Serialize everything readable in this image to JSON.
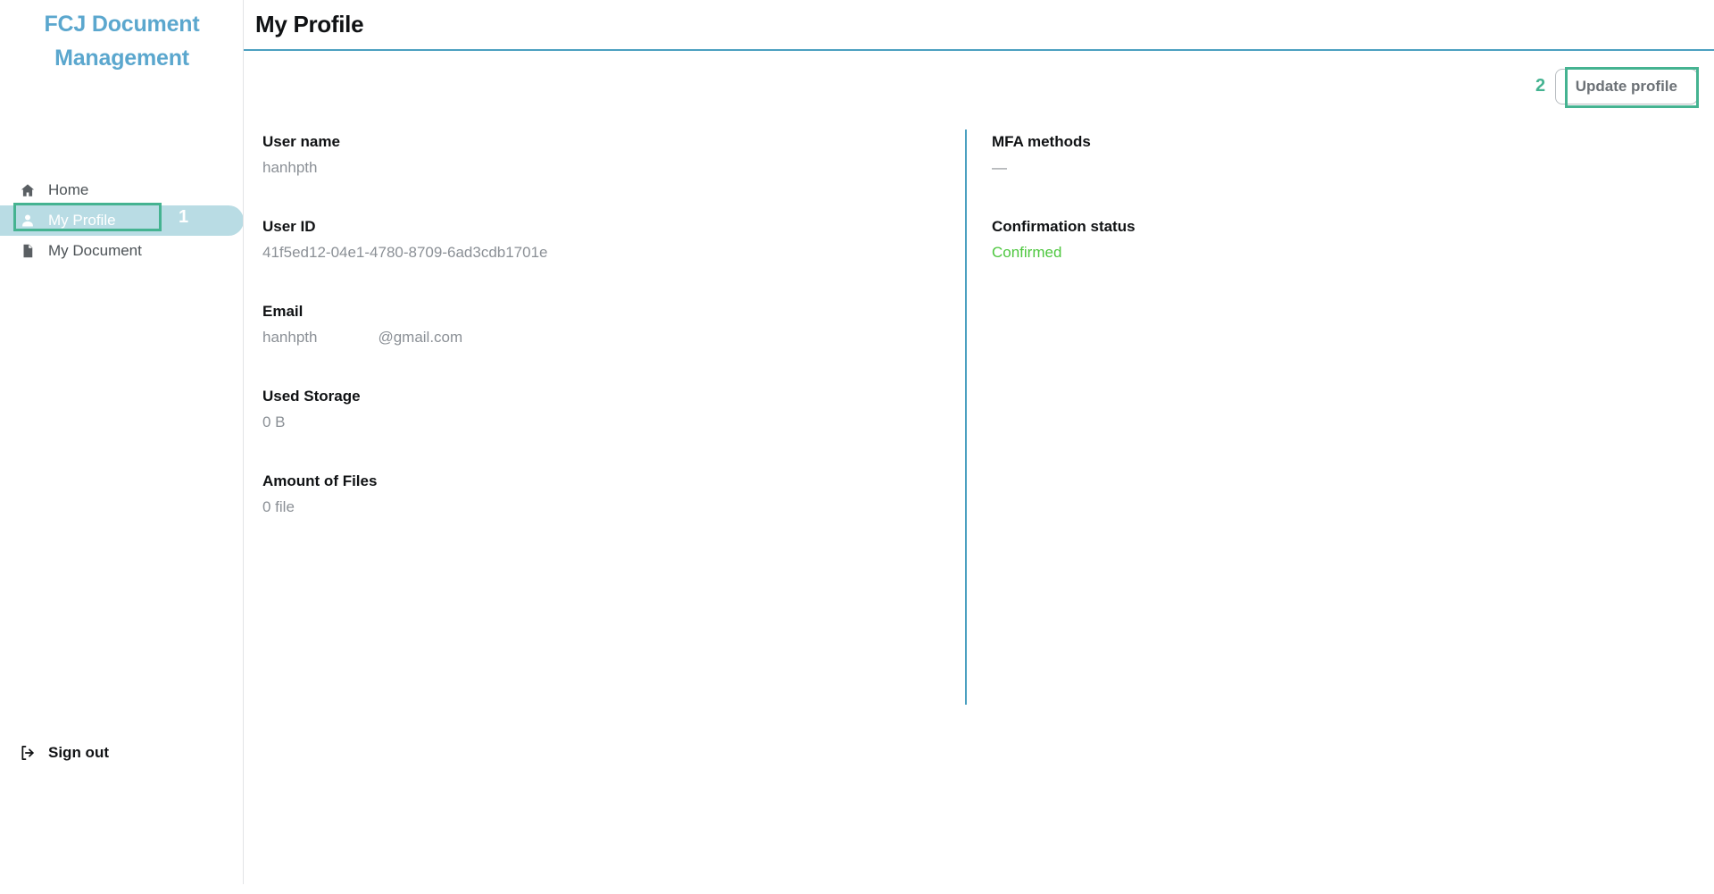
{
  "sidebar": {
    "brand": {
      "line1": "FCJ Document",
      "line2": "Management"
    },
    "items": [
      {
        "label": "Home",
        "icon": "home-icon",
        "active": false
      },
      {
        "label": "My Profile",
        "icon": "user-icon",
        "active": true
      },
      {
        "label": "My Document",
        "icon": "document-icon",
        "active": false
      }
    ],
    "signout": {
      "label": "Sign out",
      "icon": "logout-icon"
    }
  },
  "header": {
    "title": "My Profile"
  },
  "toolbar": {
    "update_profile_label": "Update profile"
  },
  "annotations": [
    {
      "number": "1",
      "target": "sidebar-item-my-profile"
    },
    {
      "number": "2",
      "target": "update-profile-button"
    }
  ],
  "profile": {
    "left_column": [
      {
        "label": "User name",
        "value": "hanhpth"
      },
      {
        "label": "User ID",
        "value": "41f5ed12-04e1-4780-8709-6ad3cdb1701e"
      },
      {
        "label": "Email",
        "value_prefix": "hanhpth",
        "value_suffix": "@gmail.com"
      },
      {
        "label": "Used Storage",
        "value": "0 B"
      },
      {
        "label": "Amount of Files",
        "value": "0 file"
      }
    ],
    "right_column": [
      {
        "label": "MFA methods",
        "value": "—"
      },
      {
        "label": "Confirmation status",
        "value": "Confirmed",
        "status": "ok"
      }
    ]
  },
  "colors": {
    "brand": "#5ba7ce",
    "accent_rule": "#4ba0c0",
    "active_nav_bg": "#b9dce4",
    "annotation": "#45b391",
    "status_confirmed": "#4ec73f"
  }
}
